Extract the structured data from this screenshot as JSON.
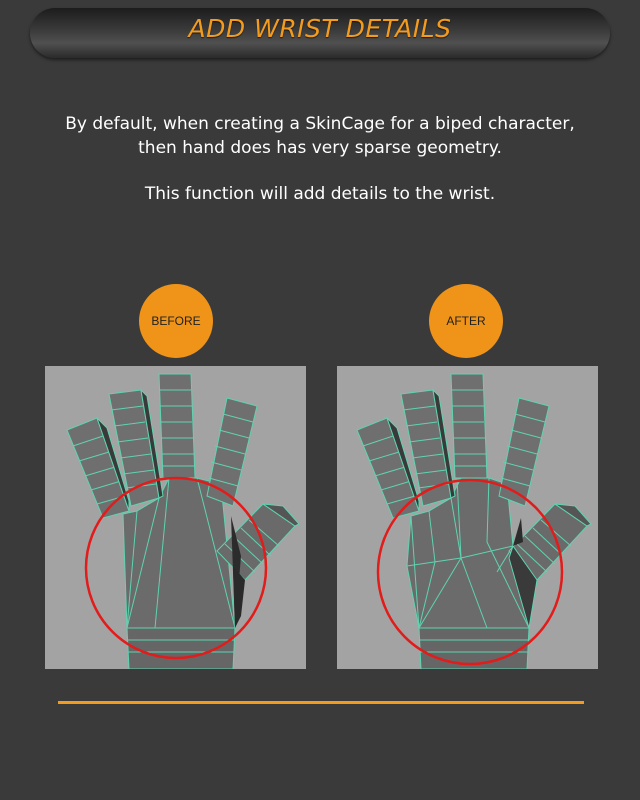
{
  "header": {
    "title": "ADD WRIST DETAILS"
  },
  "description": {
    "line1": "By default, when creating a SkinCage for a biped character,",
    "line2": "then hand does has very sparse geometry.",
    "line3": "This function will add details to the wrist."
  },
  "panels": {
    "before_label": "BEFORE",
    "after_label": "AFTER"
  },
  "colors": {
    "accent": "#f29b1f",
    "badge": "#f09419",
    "wireframe": "#5fd3b0",
    "highlight_circle": "#e21b1b",
    "viewport_bg": "#a3a3a3"
  }
}
